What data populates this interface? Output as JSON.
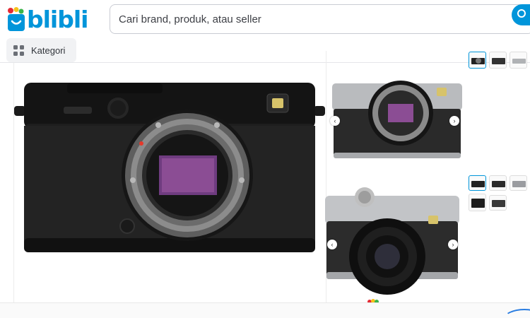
{
  "header": {
    "logo_text": "blibli",
    "search_placeholder": "Cari brand, produk, atau seller"
  },
  "nav": {
    "kategori_label": "Kategori"
  },
  "colors": {
    "brand": "#0095da",
    "logo_bag_yellow": "#f5c21b",
    "logo_bag_red": "#e52a34",
    "border": "#c9ccd3"
  },
  "icons": [
    "blibli-bag-logo-icon",
    "grid-icon",
    "search-icon",
    "chevron-left-icon",
    "chevron-right-icon"
  ]
}
